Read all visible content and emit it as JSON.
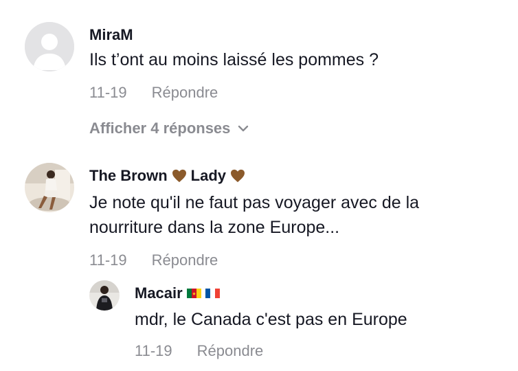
{
  "comments": [
    {
      "username": "MiraM",
      "text_lines": [
        "Ils t’ont au moins laissé les pommes ?"
      ],
      "date": "11-19",
      "reply_label": "Répondre",
      "view_replies_label": "Afficher 4 réponses",
      "avatar": "default-avatar-icon"
    },
    {
      "username_part1": "The Brown",
      "username_part2": "Lady",
      "text_lines": [
        "Je note qu'il ne faut pas voyager avec de la",
        "nourriture dans la zone Europe..."
      ],
      "date": "11-19",
      "reply_label": "Répondre",
      "avatar": "user-photo"
    }
  ],
  "reply": {
    "username": "Macair",
    "text": "mdr, le Canada c'est pas en Europe",
    "date": "11-19",
    "reply_label": "Répondre",
    "avatar": "user-photo"
  },
  "colors": {
    "text_primary": "#161823",
    "text_secondary": "#8a8b91",
    "heart": "#8b5a2b"
  }
}
